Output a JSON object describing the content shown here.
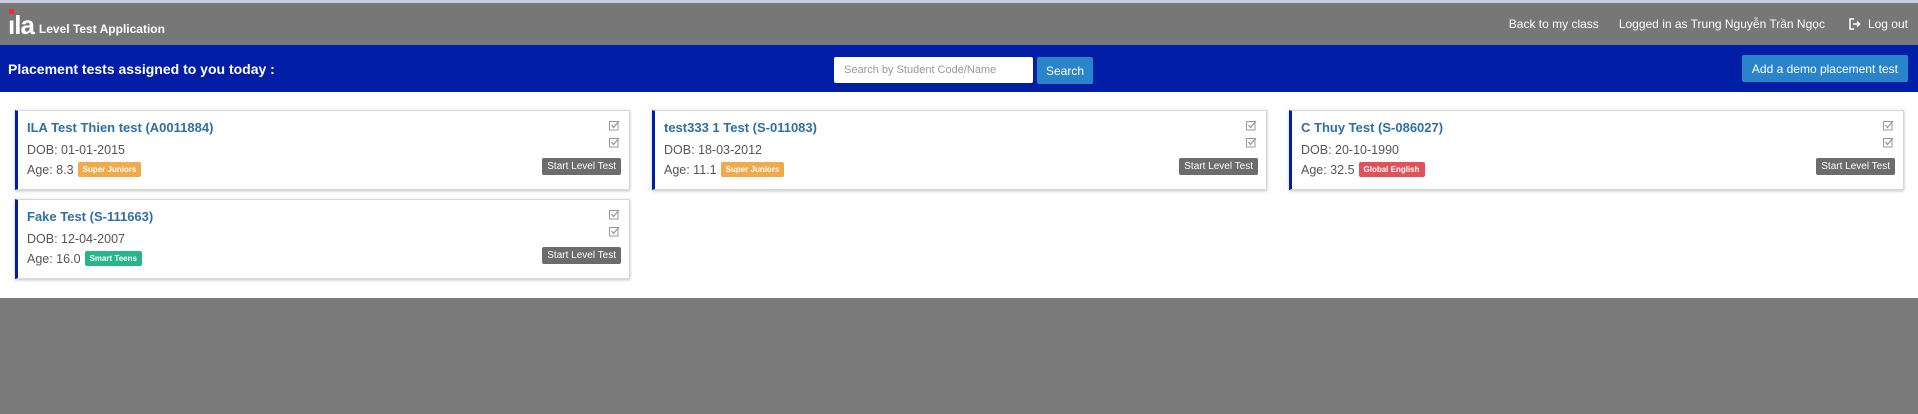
{
  "header": {
    "logo": "ila",
    "app_title": "Level Test Application",
    "back_label": "Back to my class",
    "user_label": "Logged in as Trung Nguyễn Trần Ngọc",
    "logout_label": "Log out"
  },
  "banner": {
    "title": "Placement tests assigned to you today :",
    "search_placeholder": "Search by Student Code/Name",
    "search_label": "Search",
    "demo_label": "Add a demo placement test"
  },
  "cards": [
    {
      "name": "ILA Test Thien test (A0011884)",
      "dob": "DOB: 01-01-2015",
      "age": "Age: 8.3",
      "badge": "Super Juniors",
      "badge_color": "#f0a94b",
      "start_label": "Start Level Test"
    },
    {
      "name": "test333 1 Test (S-011083)",
      "dob": "DOB: 18-03-2012",
      "age": "Age: 11.1",
      "badge": "Super Juniors",
      "badge_color": "#f0a94b",
      "start_label": "Start Level Test"
    },
    {
      "name": "C Thuy Test (S-086027)",
      "dob": "DOB: 20-10-1990",
      "age": "Age: 32.5",
      "badge": "Global English",
      "badge_color": "#e0515a",
      "start_label": "Start Level Test"
    },
    {
      "name": "Fake Test (S-111663)",
      "dob": "DOB: 12-04-2007",
      "age": "Age: 16.0",
      "badge": "Smart Teens",
      "badge_color": "#27b58a",
      "start_label": "Start Level Test"
    }
  ]
}
